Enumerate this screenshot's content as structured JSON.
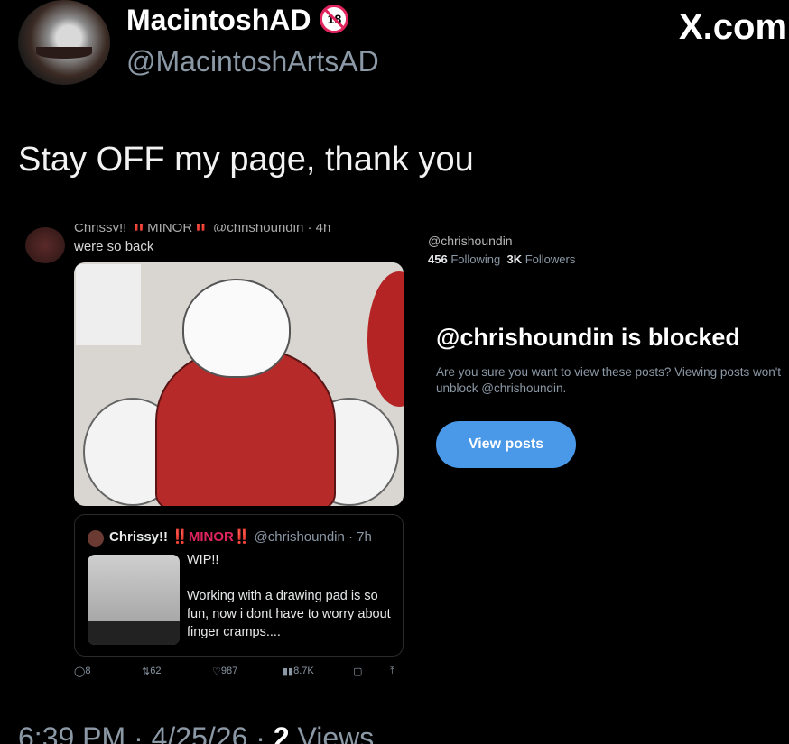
{
  "author": {
    "display_name": "MacintoshAD",
    "age_badge": "18",
    "handle": "@MacintoshArtsAD"
  },
  "brand": "X.com",
  "post": {
    "text": "Stay OFF my page, thank you",
    "time": "6:39 PM · 4/25/26 · ",
    "views_count": "2",
    "views_label": "Views"
  },
  "embed": {
    "cut_off_header": "Chrissy!! ‼️MINOR‼️ @chrishoundin · 4h",
    "body": "were so back",
    "quote": {
      "name": "Chrissy!! ",
      "minor_tag": "‼️MINOR‼️",
      "handle_time": "@chrishoundin · 7h",
      "line1": "WIP!!",
      "line2": "Working with a drawing pad is so fun, now i dont have to worry about finger cramps...."
    },
    "actions": {
      "replies": "8",
      "reposts": "62",
      "likes": "987",
      "views": "8.7K"
    }
  },
  "blocked_panel": {
    "handle": "@chrishoundin",
    "following_count": "456",
    "following_label": "Following",
    "followers_count": "3K",
    "followers_label": "Followers",
    "title": "@chrishoundin is blocked",
    "message": "Are you sure you want to view these posts? Viewing posts won't unblock @chrishoundin.",
    "button": "View posts",
    "button_color": "#4a98e8"
  }
}
